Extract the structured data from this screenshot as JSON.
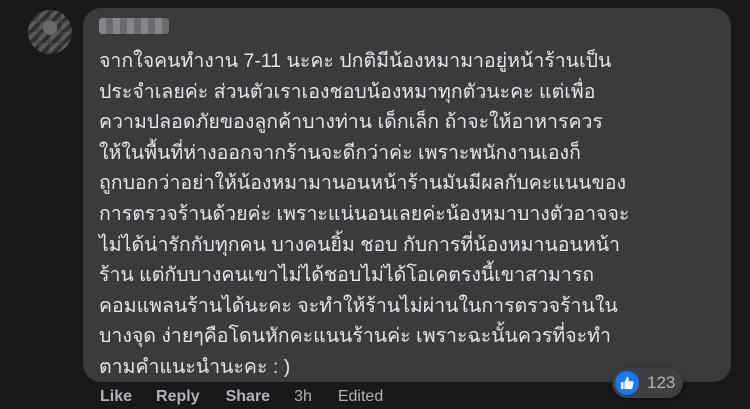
{
  "comment": {
    "author": "",
    "text_lines": [
      "จากใจคนทำงาน 7-11 นะคะ ปกติมีน้องหมามาอยู่หน้าร้านเป็น",
      "ประจำเลยค่ะ ส่วนตัวเราเองชอบน้องหมาทุกตัวนะคะ แต่เพื่อ",
      "ความปลอดภัยของลูกค้าบางท่าน เด็กเล็ก ถ้าจะให้อาหารควร",
      "ให้ในพื้นที่ห่างออกจากร้านจะดีกว่าค่ะ เพราะพนักงานเองก็",
      "ถูกบอกว่าอย่าให้น้องหมามานอนหน้าร้านมันมีผลกับคะแนนของ",
      "การตรวจร้านด้วยค่ะ เพราะแน่นอนเลยค่ะน้องหมาบางตัวอาจจะ",
      "ไม่ได้น่ารักกับทุกคน บางคนยิ้ม ชอบ กับการที่น้องหมานอนหน้า",
      "ร้าน แต่กับบางคนเขาไม่ได้ชอบไม่ได้โอเคตรงนี้เขาสามารถ",
      "คอมแพลนร้านได้นะคะ จะทำให้ร้านไม่ผ่านในการตรวจร้านใน",
      "บางจุด ง่ายๆคือโดนหักคะแนนร้านค่ะ เพราะฉะนั้นควรที่จะทำ",
      "ตามคำแนะนำนะคะ : )"
    ]
  },
  "actions": {
    "like": "Like",
    "reply": "Reply",
    "share": "Share",
    "time": "3h",
    "edited": "Edited"
  },
  "reactions": {
    "icon": "thumbs-up-icon",
    "count": "123",
    "color": "#1877f2"
  },
  "colors": {
    "background": "#18191a",
    "bubble": "#3a3b3c",
    "text": "#e4e6eb",
    "secondary_text": "#b0b3b8"
  }
}
